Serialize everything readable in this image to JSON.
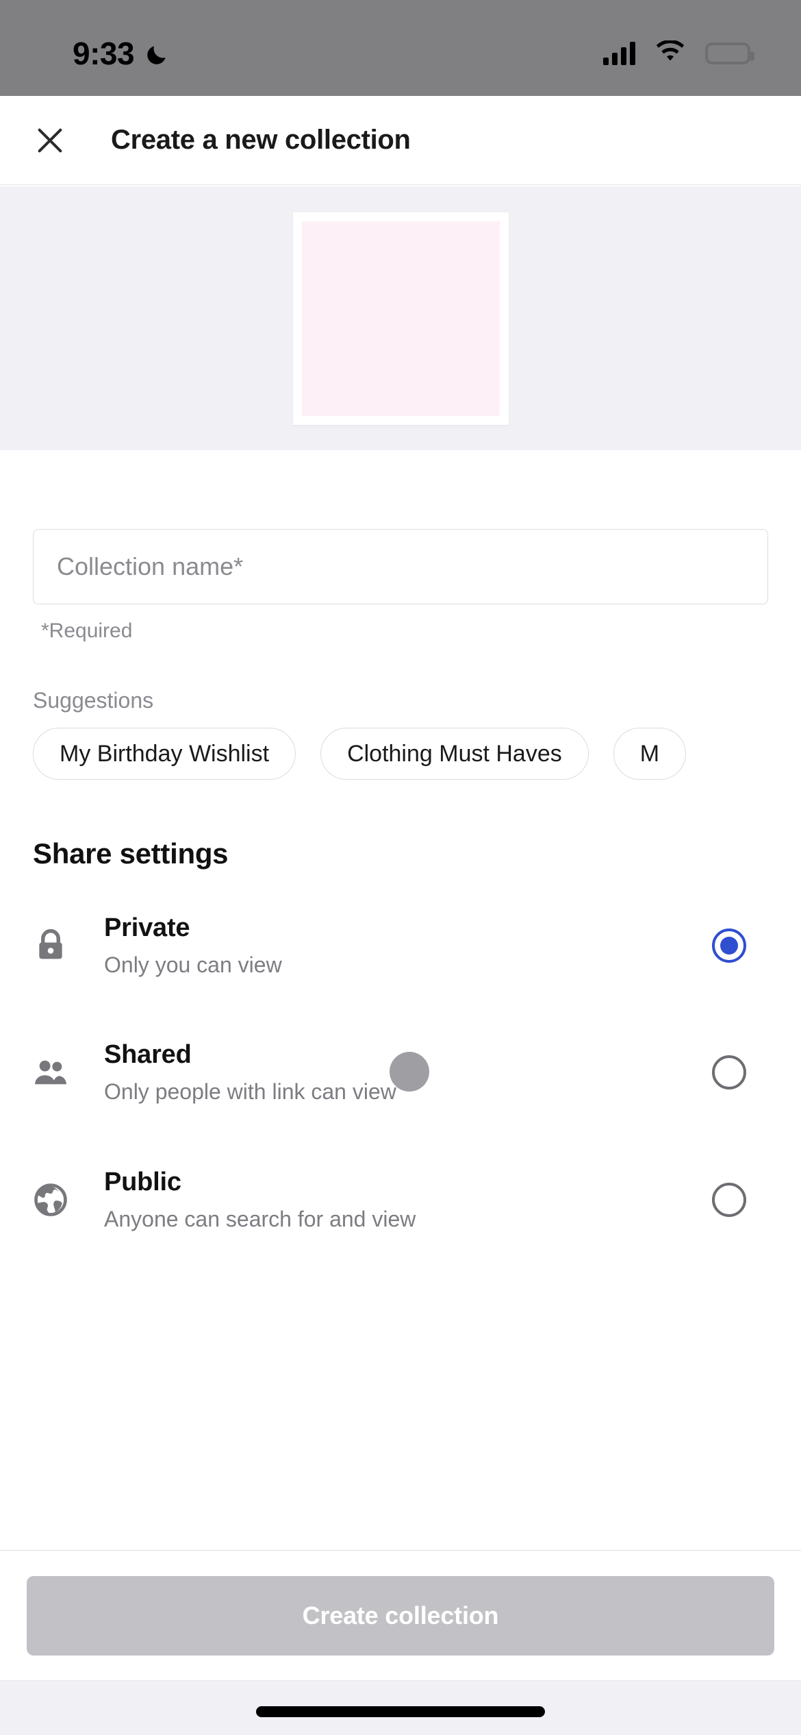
{
  "status_bar": {
    "time": "9:33",
    "moon_icon": "crescent-moon-icon",
    "signal_icon": "cellular-signal-icon",
    "wifi_icon": "wifi-icon",
    "battery_icon": "battery-full-icon"
  },
  "header": {
    "close_icon": "close-x-icon",
    "title": "Create a new collection"
  },
  "hero": {
    "thumbnail_name": "collection-cover-thumbnail",
    "frame_color": "#ffffff",
    "inner_color": "#fdf0f6",
    "background_color": "#f1f1f5"
  },
  "form": {
    "name_placeholder": "Collection name*",
    "name_value": "",
    "required_note": "*Required"
  },
  "suggestions": {
    "label": "Suggestions",
    "chips": [
      "My Birthday Wishlist",
      "Clothing Must Haves",
      "M"
    ]
  },
  "share_settings": {
    "title": "Share settings",
    "selected": "private",
    "options": [
      {
        "id": "private",
        "icon": "lock-icon",
        "title": "Private",
        "subtitle": "Only you can view",
        "selected": true
      },
      {
        "id": "shared",
        "icon": "people-icon",
        "title": "Shared",
        "subtitle": "Only people with link can view",
        "selected": false
      },
      {
        "id": "public",
        "icon": "globe-icon",
        "title": "Public",
        "subtitle": "Anyone can search for and view",
        "selected": false
      }
    ]
  },
  "footer": {
    "cta_label": "Create collection",
    "cta_enabled": false
  },
  "colors": {
    "accent": "#2f4ed0",
    "disabled_button": "#c2c2c6",
    "status_bar": "#808083",
    "muted_text": "#8a8a90"
  },
  "cursor": {
    "name": "touch-cursor",
    "color": "#9e9ea3"
  }
}
